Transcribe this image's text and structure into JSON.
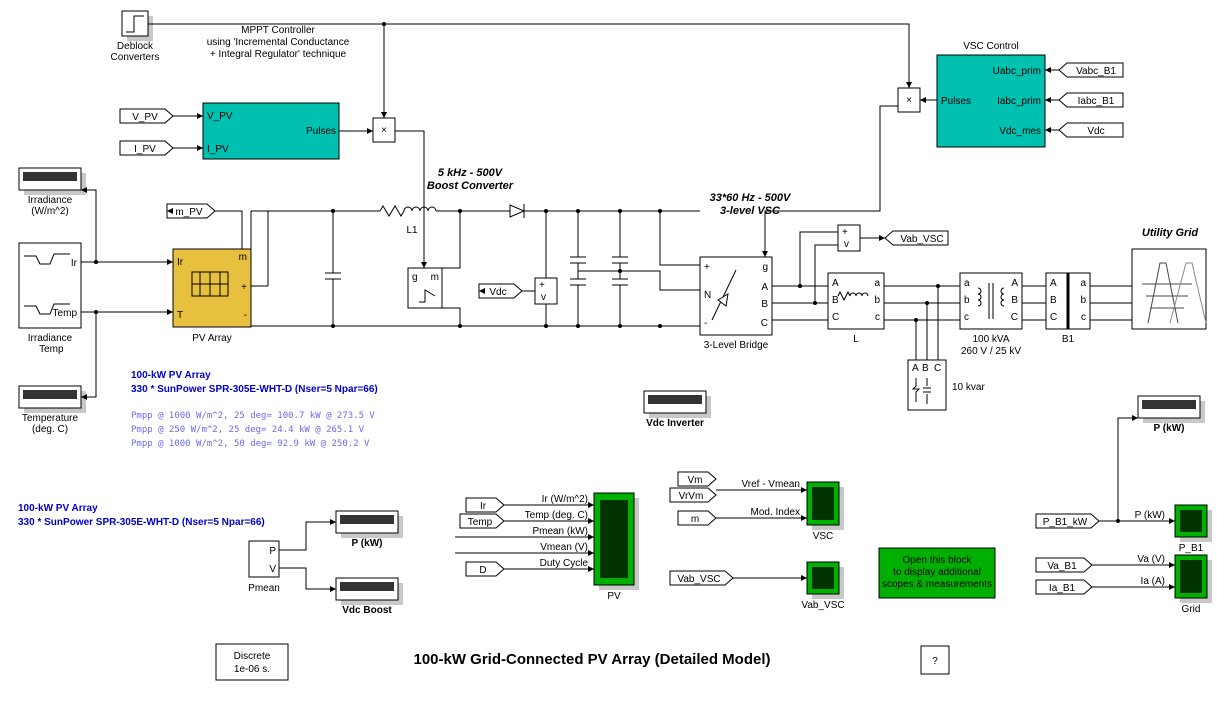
{
  "title": "100-kW Grid-Connected PV Array (Detailed Model)",
  "deblock": "Deblock\nConverters",
  "mppt_desc": "MPPT Controller\nusing  'Incremental Conductance\n+ Integral Regulator'  technique",
  "mppt": {
    "in1": "V_PV",
    "in2": "I_PV",
    "out": "Pulses"
  },
  "vsc_ctrl": {
    "title": "VSC Control",
    "out": "Pulses",
    "in1": "Uabc_prim",
    "in2": "Iabc_prim",
    "in3": "Vdc_mes"
  },
  "vsc_tags": {
    "t1": "Vabc_B1",
    "t2": "Iabc_B1",
    "t3": "Vdc"
  },
  "boost_lbl": "5 kHz - 500V\nBoost Converter",
  "vsc_lbl": "33*60 Hz - 500V\n3-level VSC",
  "grid_lbl": "Utility Grid",
  "L1": "L1",
  "bridge": "3-Level Bridge",
  "L": "L",
  "xfmr": "100 kVA\n260 V / 25 kV",
  "B1": "B1",
  "kvar": "10  kvar",
  "Vdc_tag": "Vdc",
  "Vab_tag": "Vab_VSC",
  "scopes": {
    "irr": "Irradiance\n(W/m^2)",
    "irr_temp": "Irradiance\n Temp",
    "temp": "Temperature\n(deg. C)",
    "vdc_inv": "Vdc Inverter",
    "pkw": "P (kW)",
    "pkw2": "P (kW)",
    "vdc_boost": "Vdc Boost",
    "pv": "PV",
    "vsc": "VSC",
    "vab": "Vab_VSC",
    "pb1": "P_B1",
    "grid": "Grid"
  },
  "sig_port": {
    "ir": "Ir",
    "temp": "Temp"
  },
  "pvblk": {
    "name": "PV Array",
    "ir": "Ir",
    "t": "T",
    "m": "m",
    "p": "+",
    "n": "-"
  },
  "tags": {
    "vpv": "V_PV",
    "ipv": "I_PV",
    "mpv": "m_PV",
    "vab": "Vab_VSC",
    "pb1": "P_B1_kW",
    "va": "Va_B1",
    "ia": "Ia_B1",
    "vm": "Vm",
    "vrvm": "VrVm",
    "m": "m",
    "ir": "Ir",
    "temp": "Temp",
    "d": "D",
    "pkw": "P (kW)",
    "va2": "Va (V)",
    "ia2": "Ia (A)",
    "pmean": "Pmean",
    "pblk": "P",
    "vblk": "V"
  },
  "pv_info1": "100-kW  PV Array",
  "pv_info2": "330 * SunPower SPR-305E-WHT-D  (Nser=5 Npar=66)",
  "pmpp": [
    "Pmpp @ 1000 W/m^2, 25 deg= 100.7 kW @ 273.5 V",
    "Pmpp @  250 W/m^2, 25 deg= 24.4  kW @ 265.1 V",
    "Pmpp @ 1000 W/m^2, 50 deg= 92.9  kW @ 250.2 V"
  ],
  "pv_scope": {
    "l1": "Ir (W/m^2)",
    "l2": "Temp (deg. C)",
    "l3": "Pmean (kW)",
    "l4": "Vmean (V)",
    "l5": "Duty Cycle"
  },
  "vsc_scope": {
    "l1": "Vref - Vmean",
    "l2": "Mod. Index"
  },
  "powergui": "Discrete\n1e-06 s.",
  "help": "?",
  "open_note": "Open this block\nto display additional\nscopes & measurements"
}
